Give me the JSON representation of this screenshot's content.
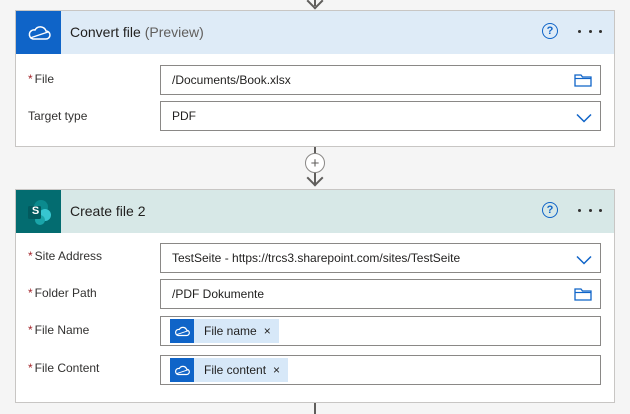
{
  "convert_card": {
    "title": "Convert file",
    "title_suffix": "(Preview)",
    "connector_icon": "onedrive-cloud-icon",
    "fields": {
      "file": {
        "label": "File",
        "required": true,
        "value": "/Documents/Book.xlsx",
        "icon": "folder-icon"
      },
      "target_type": {
        "label": "Target type",
        "required": false,
        "value": "PDF",
        "icon": "chevron-down-icon"
      }
    }
  },
  "insert_step": {
    "symbol": "+"
  },
  "create_card": {
    "title": "Create file 2",
    "connector_icon": "sharepoint-icon",
    "connector_letter": "S",
    "fields": {
      "site_address": {
        "label": "Site Address",
        "required": true,
        "value": "TestSeite - https://trcs3.sharepoint.com/sites/TestSeite",
        "icon": "chevron-down-icon"
      },
      "folder_path": {
        "label": "Folder Path",
        "required": true,
        "value": "/PDF Dokumente",
        "icon": "folder-icon"
      },
      "file_name": {
        "label": "File Name",
        "required": true,
        "token": {
          "label": "File name",
          "icon": "onedrive-cloud-icon",
          "remove": "×"
        }
      },
      "file_content": {
        "label": "File Content",
        "required": true,
        "token": {
          "label": "File content",
          "icon": "onedrive-cloud-icon",
          "remove": "×"
        }
      }
    }
  },
  "header_actions": {
    "help": "?"
  },
  "colors": {
    "onedrive_blue": "#0f64c8",
    "sharepoint_teal": "#036c70",
    "required_red": "#a4262c",
    "convert_header_bg": "#deebf7",
    "create_header_bg": "#d7e8e7",
    "token_bg": "#d7e8f8"
  }
}
